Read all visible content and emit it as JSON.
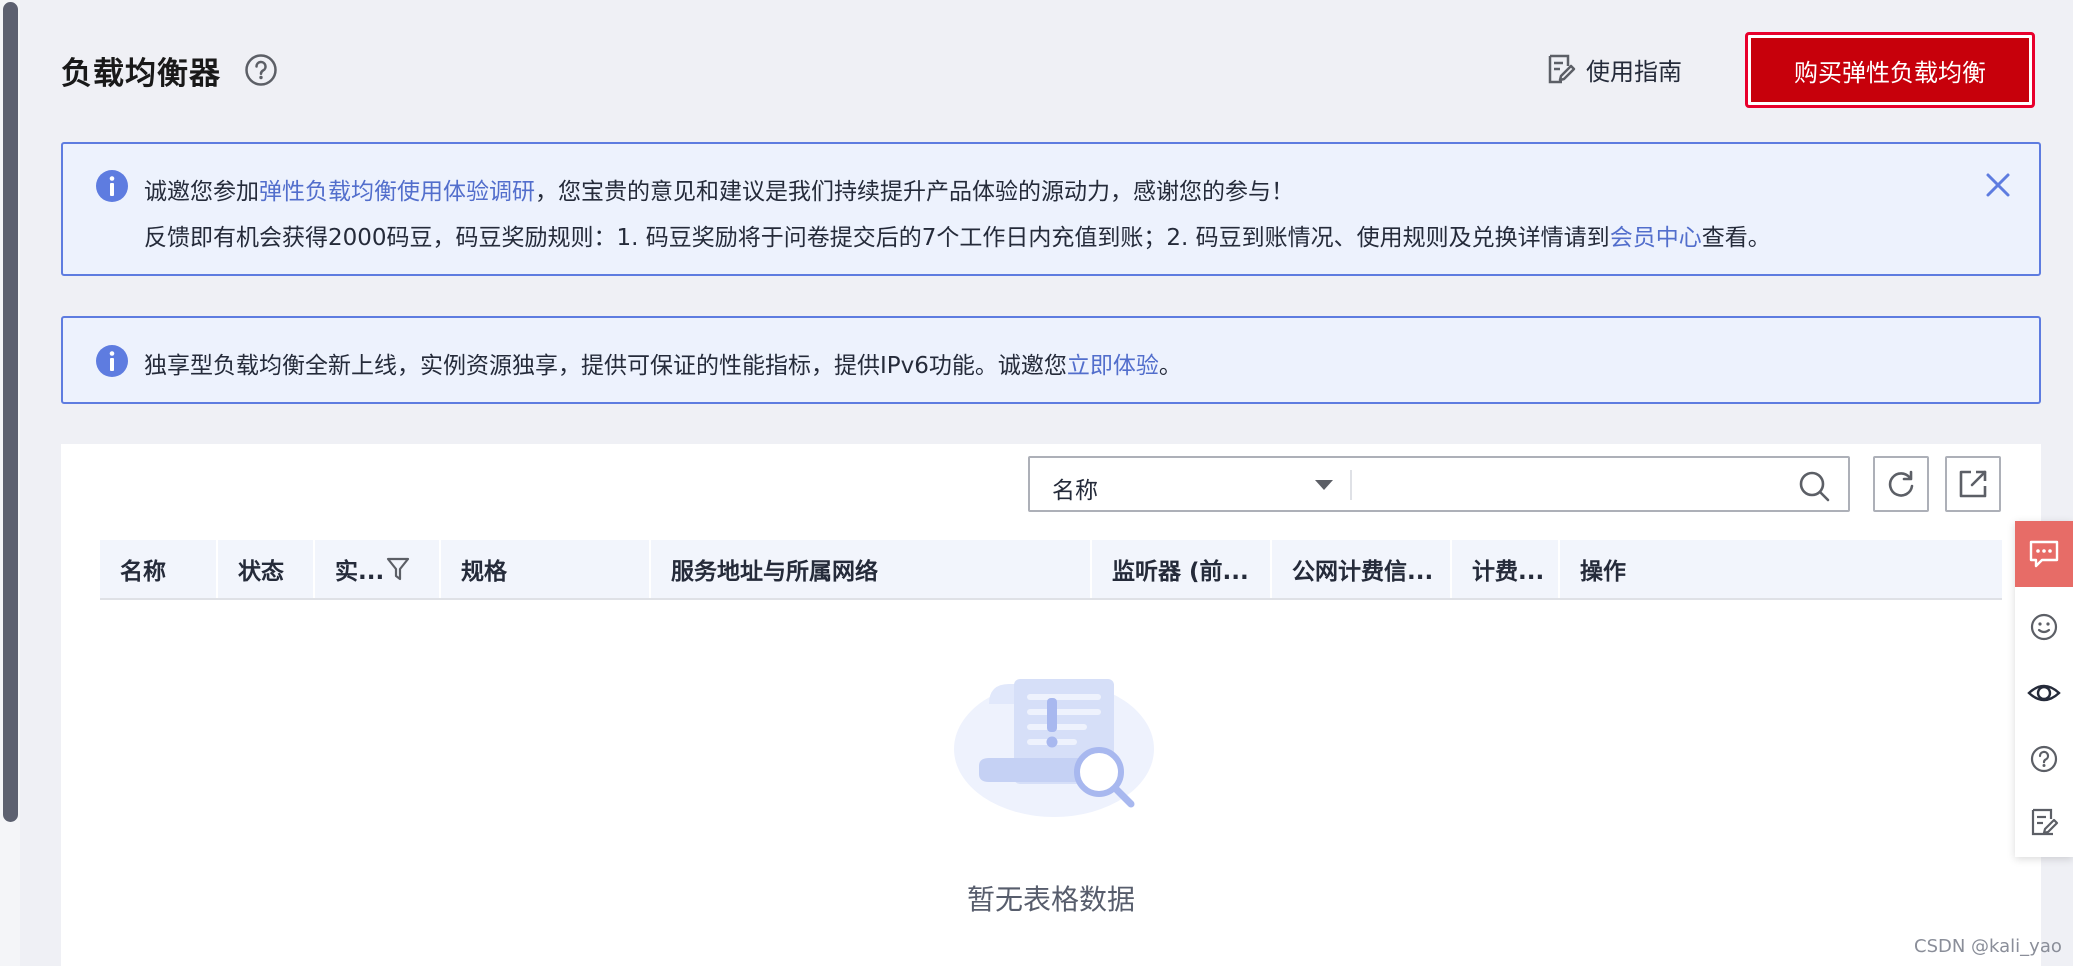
{
  "header": {
    "title": "负载均衡器",
    "guide_label": "使用指南",
    "buy_button_label": "购买弹性负载均衡"
  },
  "notice_survey": {
    "line1_prefix": "诚邀您参加",
    "line1_link": "弹性负载均衡使用体验调研",
    "line1_suffix": "，您宝贵的意见和建议是我们持续提升产品体验的源动力，感谢您的参与！",
    "line2_prefix": "反馈即有机会获得2000码豆，码豆奖励规则：1. 码豆奖励将于问卷提交后的7个工作日内充值到账；2. 码豆到账情况、使用规则及兑换详情请到",
    "line2_link": "会员中心",
    "line2_suffix": "查看。"
  },
  "notice_dedicated": {
    "prefix": "独享型负载均衡全新上线，实例资源独享，提供可保证的性能指标，提供IPv6功能。诚邀您",
    "link": "立即体验",
    "suffix": "。"
  },
  "filter": {
    "selected_field": "名称",
    "input_value": "",
    "input_placeholder": ""
  },
  "table": {
    "columns": [
      "名称",
      "状态",
      "实...",
      "规格",
      "服务地址与所属网络",
      "监听器 (前...",
      "公网计费信...",
      "计费...",
      "操作"
    ],
    "rows": [],
    "empty_text": "暂无表格数据"
  },
  "watermark": "CSDN @kali_yao",
  "colors": {
    "primary_red": "#c7000b",
    "link_blue": "#526ecc",
    "notice_border": "#5e7ce0",
    "notice_bg": "#edf2fd",
    "float_accent": "#e76c67"
  },
  "icons": {
    "help": "question-circle-icon",
    "guide": "document-edit-icon",
    "info": "info-circle-icon",
    "close": "close-icon",
    "search": "search-icon",
    "refresh": "refresh-icon",
    "export": "export-icon",
    "column_filter": "filter-icon",
    "float": [
      "chat-icon",
      "smile-icon",
      "eye-icon",
      "help-icon",
      "edit-note-icon"
    ]
  }
}
